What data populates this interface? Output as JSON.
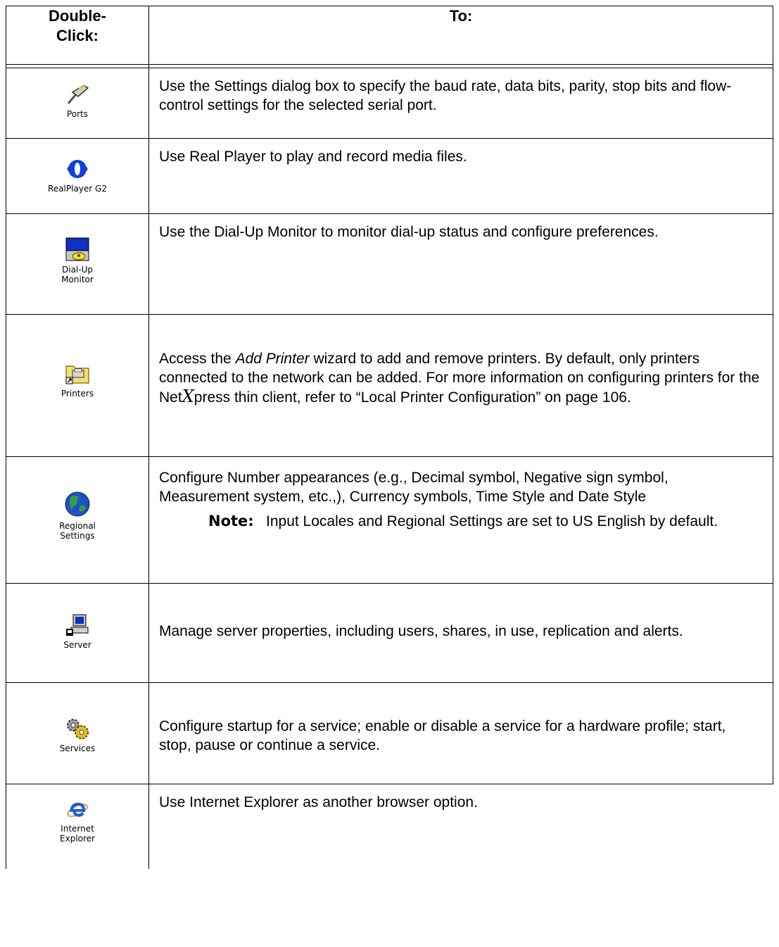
{
  "header": {
    "col1": "Double-\nClick:",
    "col2": "To:"
  },
  "rows": [
    {
      "icon": "ports-icon",
      "label": "Ports",
      "desc": "Use the Settings dialog box to specify the baud rate, data bits, parity, stop bits and flow-control settings for the selected serial port."
    },
    {
      "icon": "realplayer-icon",
      "label": "RealPlayer G2",
      "desc": "Use Real Player to play and record media files."
    },
    {
      "icon": "dialup-monitor-icon",
      "label": "Dial-Up\nMonitor",
      "desc": "Use the Dial-Up Monitor to monitor dial-up status and configure preferences."
    },
    {
      "icon": "printers-folder-icon",
      "label": "Printers",
      "desc_part1": "Access the ",
      "desc_em": "Add Printer",
      "desc_part2": " wizard to add and remove printers. By default, only printers connected to the network can be added. For more information on configuring printers for the Net",
      "desc_x": "X",
      "desc_part3": "press thin client, refer to “Local Printer Configuration” on page 106."
    },
    {
      "icon": "globe-icon",
      "label": "Regional\nSettings",
      "desc": "Configure Number appearances (e.g., Decimal symbol, Negative sign symbol, Measurement system, etc.,), Currency symbols, Time Style and Date Style",
      "note_label": "Note:",
      "note_text": "Input Locales and Regional Settings are set to US English by default."
    },
    {
      "icon": "server-icon",
      "label": "Server",
      "desc": "Manage server properties, including users, shares, in use, replication and alerts."
    },
    {
      "icon": "services-gears-icon",
      "label": "Services",
      "desc": "Configure startup for a service; enable or disable a service for a hardware profile; start, stop, pause or continue a service."
    },
    {
      "icon": "internet-explorer-icon",
      "label": "Internet\nExplorer",
      "desc": "Use Internet Explorer as another browser option."
    }
  ]
}
